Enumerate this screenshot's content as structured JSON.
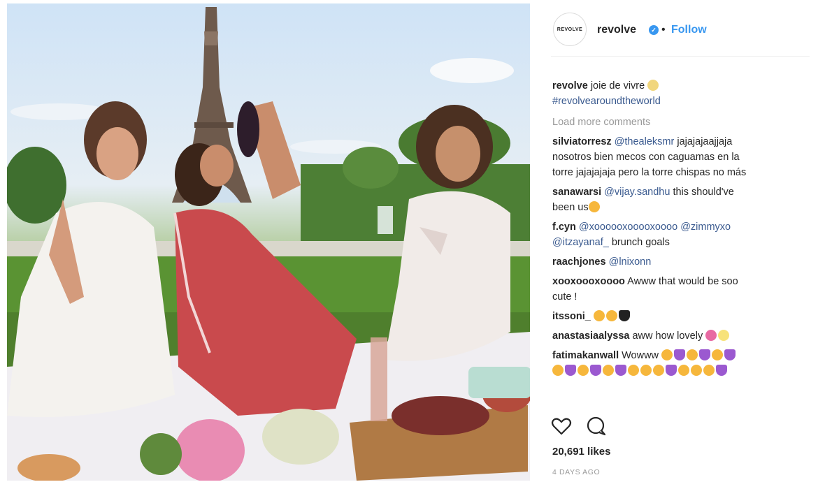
{
  "post": {
    "image_alt": "Three women having a picnic near the Eiffel Tower",
    "account": {
      "avatar_text": "REVOLVE",
      "username": "revolve",
      "separator": "•",
      "follow_label": "Follow"
    },
    "caption": {
      "username": "revolve",
      "text": "joie de vivre",
      "hashtag": "#revolvearoundtheworld"
    },
    "load_more": "Load more comments",
    "comments": [
      {
        "user": "silviatorresz",
        "mention": "@thealeksmr",
        "text1": "jajajajaajjaja",
        "line2": "nosotros bien mecos con caguamas en la",
        "line3": "torre jajajajaja pero la torre chispas no más"
      },
      {
        "user": "sanawarsi",
        "mention": "@vijay.sandhu",
        "text1": "this should've",
        "line2": "been us"
      },
      {
        "user": "f.cyn",
        "mention": "@xoooooxooooxoooo @zimmyxo",
        "mention2": "@itzayanaf_",
        "text2": "brunch goals"
      },
      {
        "user": "raachjones",
        "mention": "@lnixonn"
      },
      {
        "user": "xooxoooxoooo",
        "text1": "Awww that would be soo",
        "line2": "cute !"
      },
      {
        "user": "itssoni_"
      },
      {
        "user": "anastasiaalyssa",
        "text1": "aww how lovely"
      },
      {
        "user": "fatimakanwall",
        "text1": "Wowww"
      }
    ],
    "likes": "20,691 likes",
    "timestamp": "4 DAYS AGO",
    "colors": {
      "link": "#3897f0",
      "mention": "#3a5a8f",
      "muted": "#999999",
      "text": "#262626"
    },
    "icons": [
      "heart-icon",
      "comment-icon",
      "verified-badge-icon"
    ]
  }
}
